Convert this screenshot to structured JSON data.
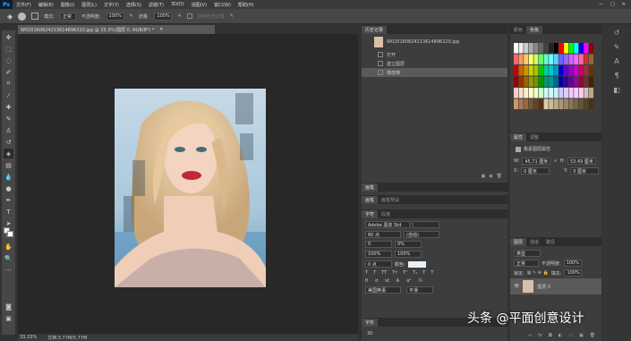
{
  "app": {
    "logo": "Ps"
  },
  "menu": [
    "文件(F)",
    "编辑(E)",
    "图像(I)",
    "图层(L)",
    "文字(Y)",
    "选择(S)",
    "滤镜(T)",
    "3D(D)",
    "视图(V)",
    "窗口(W)",
    "帮助(H)"
  ],
  "window_buttons": [
    "—",
    "□",
    "✕"
  ],
  "options": {
    "mode_label": "模式:",
    "mode_value": "正常",
    "opacity_label": "不透明度:",
    "opacity_value": "100%",
    "flow_label": "流量:",
    "flow_value": "100%",
    "erase_history": "抹到历史记录"
  },
  "document": {
    "tab_title": "W020160824213614896220.jpg @ 33.3%(图层 0, RGB/8*) *",
    "zoom": "33.33%",
    "doc_info": "文档:3.77M/5.77M"
  },
  "history": {
    "tabs": [
      "历史记录"
    ],
    "snapshot": "W020160824213614896220.jpg",
    "items": [
      "打开",
      "建立图层",
      "橡皮擦"
    ]
  },
  "color_panel": {
    "tabs": [
      "颜色",
      "色板"
    ]
  },
  "properties": {
    "tabs": [
      "属性",
      "调整"
    ],
    "title": "像素图层属性",
    "w_label": "W:",
    "w_value": "45.71 厘米",
    "h_label": "H:",
    "h_value": "53.49 厘米",
    "x_label": "X:",
    "x_value": "0 厘米",
    "y_label": "Y:",
    "y_value": "0 厘米"
  },
  "mid_panels": {
    "panel1": "画笔",
    "brush_tabs": [
      "画笔",
      "画笔预设"
    ],
    "char_tabs": [
      "字符",
      "段落"
    ],
    "font_family": "Adobe 黑体 Std",
    "font_size": "80 点",
    "leading": "(自动)",
    "kerning": "0",
    "tracking": "0%",
    "vscale": "100%",
    "hscale": "100%",
    "baseline": "0 点",
    "color_label": "颜色:",
    "lang": "美国英语",
    "aa": "平滑",
    "bottom_tab": "字形",
    "bottom_val": "30"
  },
  "layers": {
    "tabs": [
      "图层",
      "通道",
      "路径"
    ],
    "filter": "类型",
    "blend": "正常",
    "opacity_label": "不透明度:",
    "opacity_value": "100%",
    "lock_label": "锁定:",
    "fill_label": "填充:",
    "fill_value": "100%",
    "layer_name": "图层 0"
  },
  "watermark": "头条 @平面创意设计",
  "colors": {
    "accent": "#31a8ff",
    "panel": "#3d3d3d",
    "canvas": "#282828"
  }
}
